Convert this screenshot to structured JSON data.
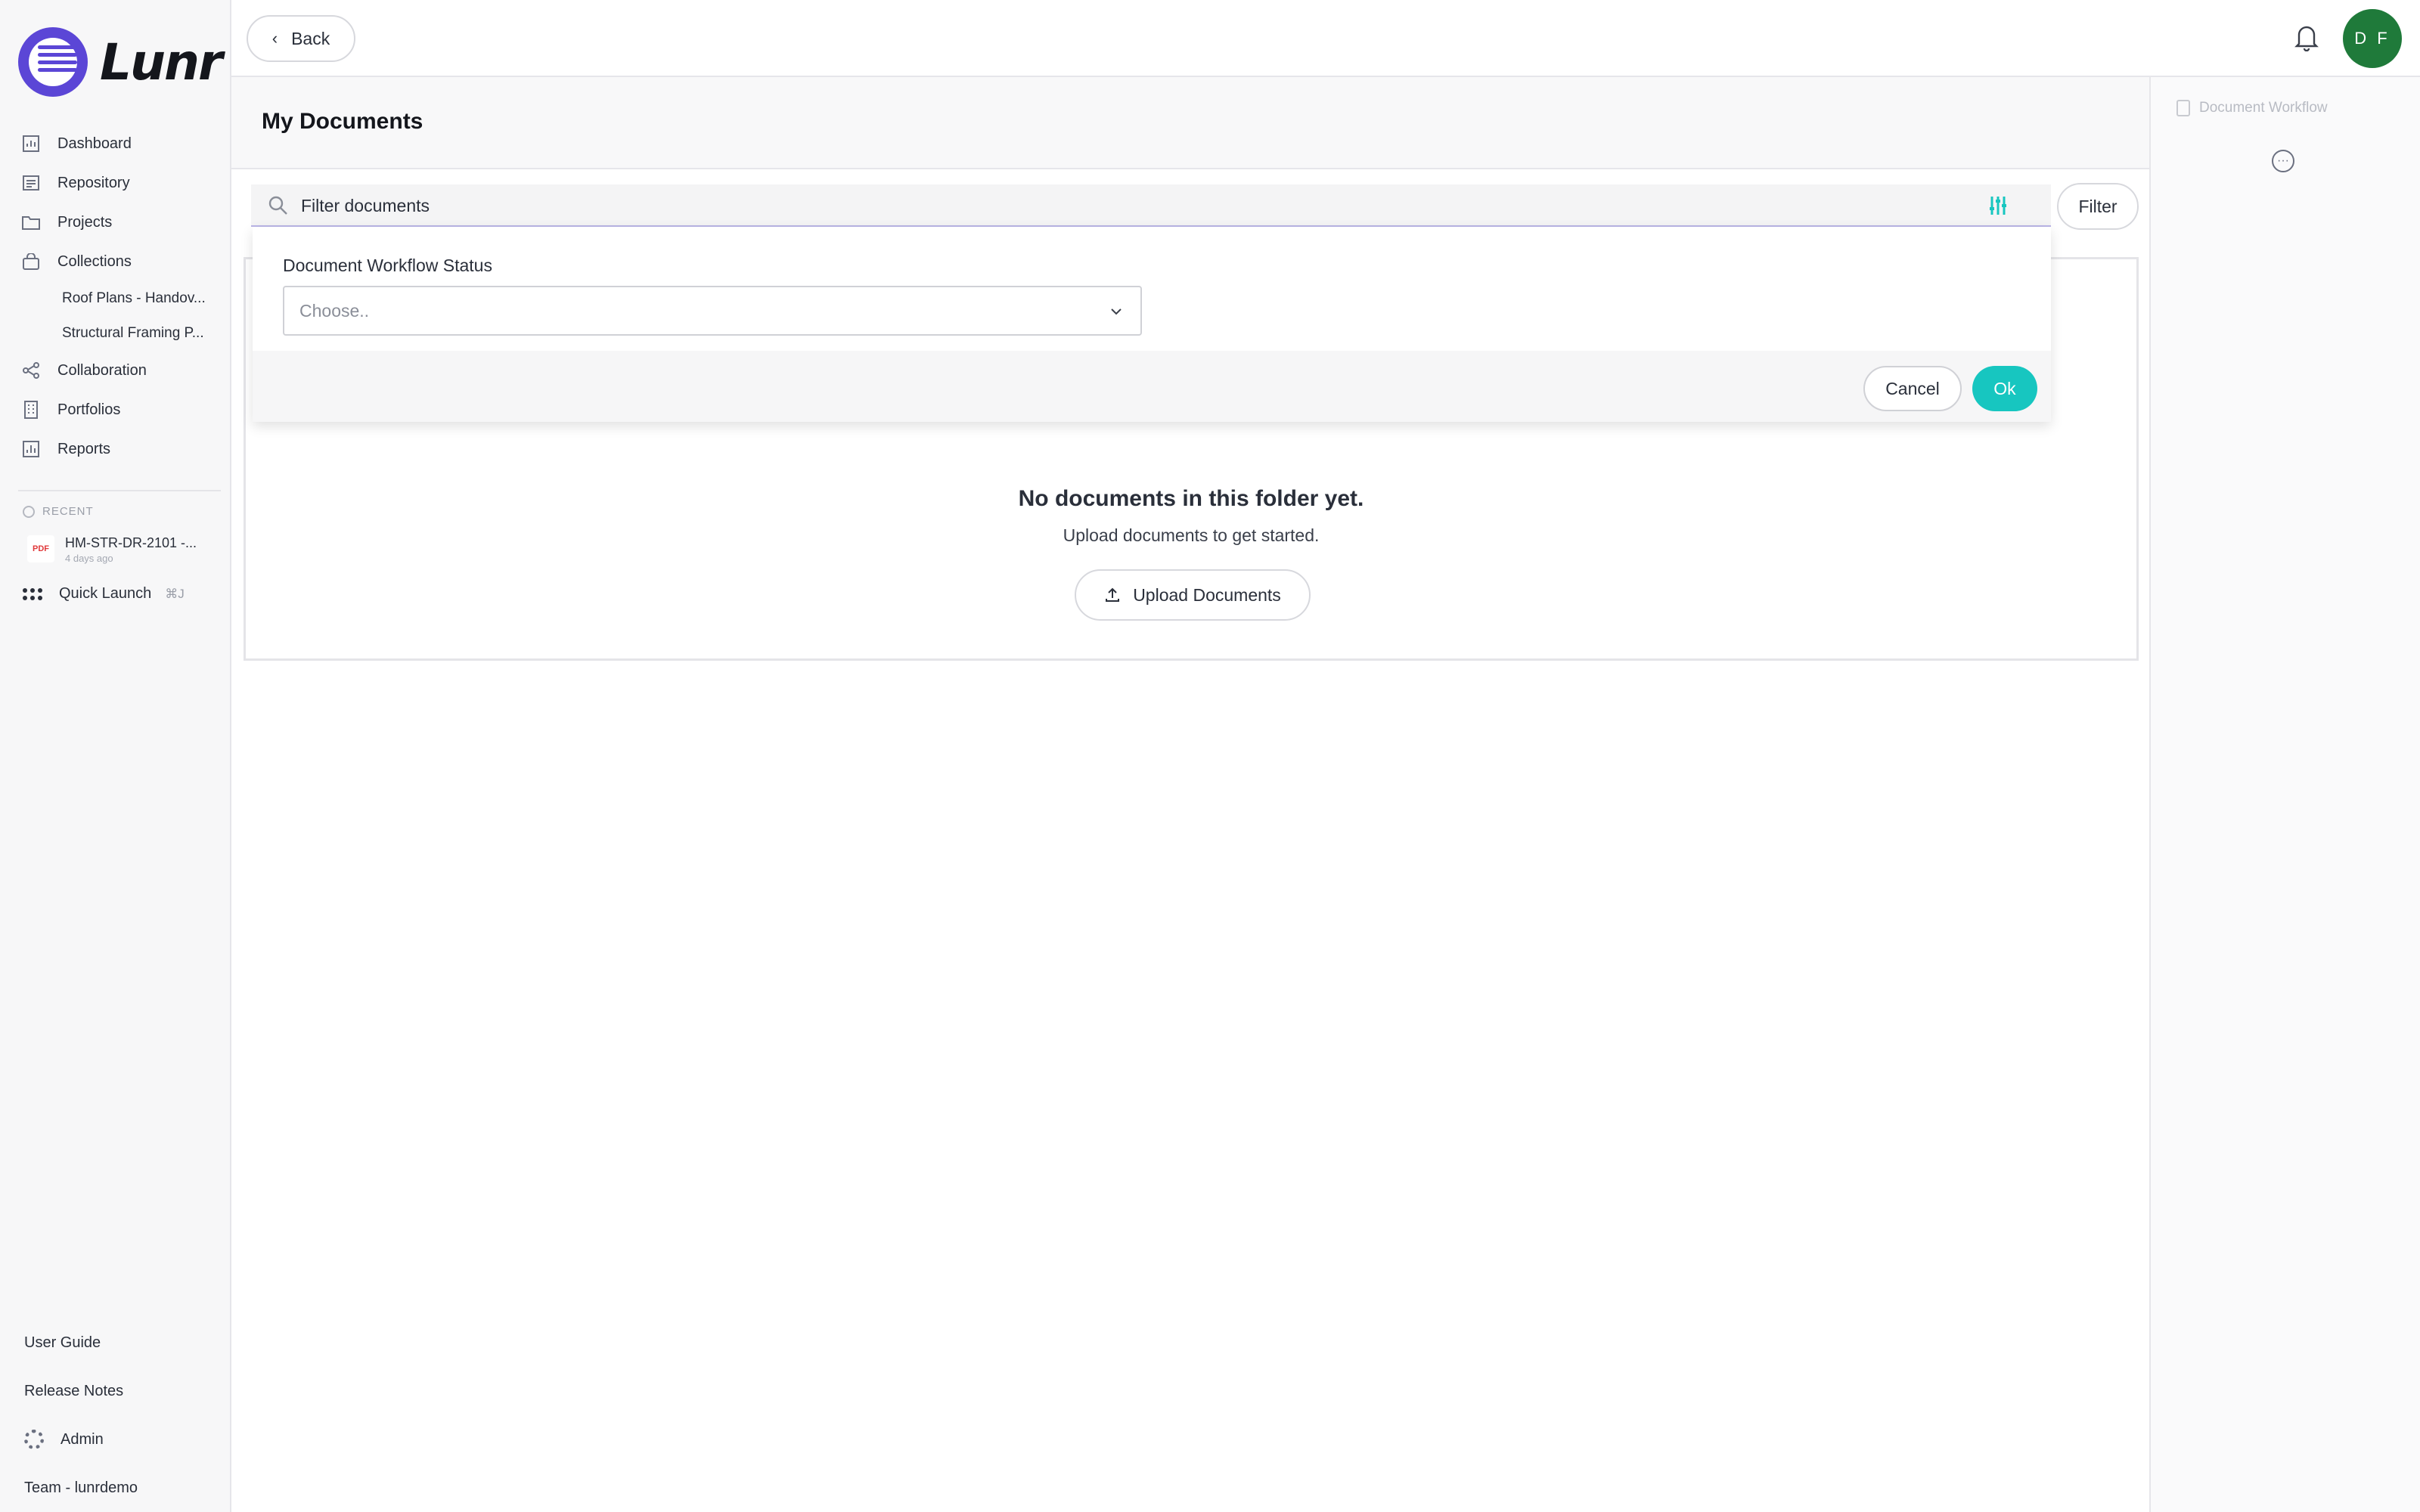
{
  "app": {
    "logo_text": "Lunr"
  },
  "sidebar": {
    "items": [
      {
        "label": "Dashboard",
        "icon": "chart-icon"
      },
      {
        "label": "Repository",
        "icon": "repository-icon"
      },
      {
        "label": "Projects",
        "icon": "folder-icon"
      },
      {
        "label": "Collections",
        "icon": "bag-icon"
      }
    ],
    "collections": [
      "Roof Plans - Handov...",
      "Structural Framing P..."
    ],
    "items2": [
      {
        "label": "Collaboration",
        "icon": "share-icon"
      },
      {
        "label": "Portfolios",
        "icon": "building-icon"
      },
      {
        "label": "Reports",
        "icon": "report-icon"
      }
    ],
    "recent_label": "RECENT",
    "recent_file": {
      "badge": "PDF",
      "name": "HM-STR-DR-2101 -...",
      "time": "4 days ago"
    },
    "quick_launch": {
      "label": "Quick Launch",
      "shortcut": "⌘J"
    },
    "footer": {
      "user_guide": "User Guide",
      "release_notes": "Release Notes",
      "admin": "Admin",
      "team": "Team - lunrdemo"
    }
  },
  "topbar": {
    "back_label": "Back",
    "avatar_initials": "D F"
  },
  "main": {
    "title": "My Documents",
    "search_placeholder": "Filter documents",
    "filter_label": "Filter",
    "empty_title": "No documents in this folder yet.",
    "empty_subtitle": "Upload documents to get started.",
    "upload_label": "Upload Documents"
  },
  "filter_panel": {
    "field_label": "Document Workflow Status",
    "select_placeholder": "Choose..",
    "cancel_label": "Cancel",
    "ok_label": "Ok"
  },
  "right_panel": {
    "title": "Document Workflow"
  },
  "colors": {
    "brand": "#5b46d6",
    "accent": "#17c6c0",
    "avatar": "#1f7a3a"
  }
}
